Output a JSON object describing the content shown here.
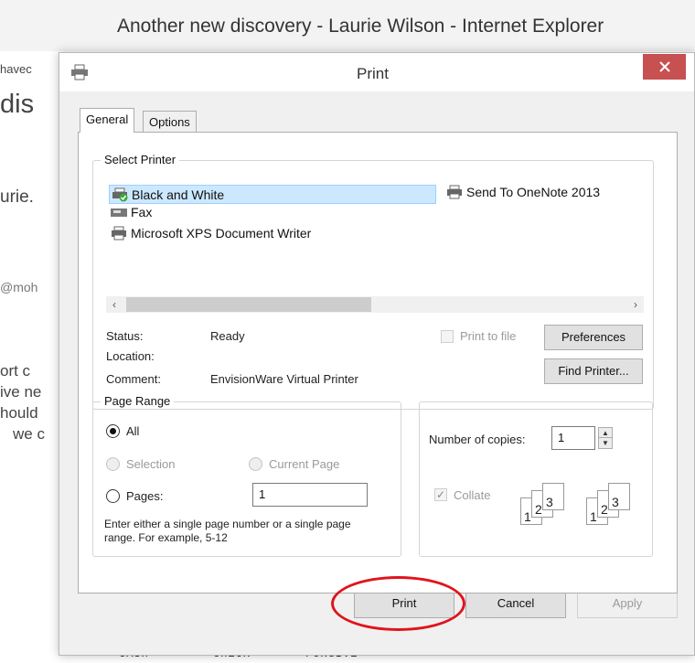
{
  "browser": {
    "title": "Another new discovery - Laurie Wilson - Internet Explorer",
    "partial_texts": [
      "havec",
      "dis",
      "urie.",
      "@moh",
      "ort c",
      "ive ne",
      "hould",
      "we c"
    ]
  },
  "dialog": {
    "title": "Print",
    "tabs": [
      "General",
      "Options"
    ],
    "select_printer": {
      "label": "Select Printer",
      "printers": [
        {
          "name": "Black and White",
          "selected": true
        },
        {
          "name": "Send To OneNote 2013"
        },
        {
          "name": "Fax"
        },
        {
          "name": "Microsoft XPS Document Writer"
        }
      ],
      "status_label": "Status:",
      "status_value": "Ready",
      "location_label": "Location:",
      "location_value": "",
      "comment_label": "Comment:",
      "comment_value": "EnvisionWare Virtual Printer",
      "print_to_file": "Print to file",
      "preferences_button": "Preferences",
      "find_printer_button": "Find Printer..."
    },
    "page_range": {
      "label": "Page Range",
      "all": "All",
      "selection": "Selection",
      "current_page": "Current Page",
      "pages": "Pages:",
      "pages_value": "1",
      "help": "Enter either a single page number or a single page range.  For example, 5-12"
    },
    "copies": {
      "label": "Number of copies:",
      "value": "1",
      "collate": "Collate",
      "collate_pages": [
        "1",
        "2",
        "3"
      ]
    },
    "buttons": {
      "print": "Print",
      "cancel": "Cancel",
      "apply": "Apply"
    }
  },
  "footer_words": [
    "CASH",
    "CHECK",
    "FORGIVE"
  ],
  "colors": {
    "close": "#c75050",
    "selection": "#cce8ff",
    "highlight": "#e0141b"
  }
}
